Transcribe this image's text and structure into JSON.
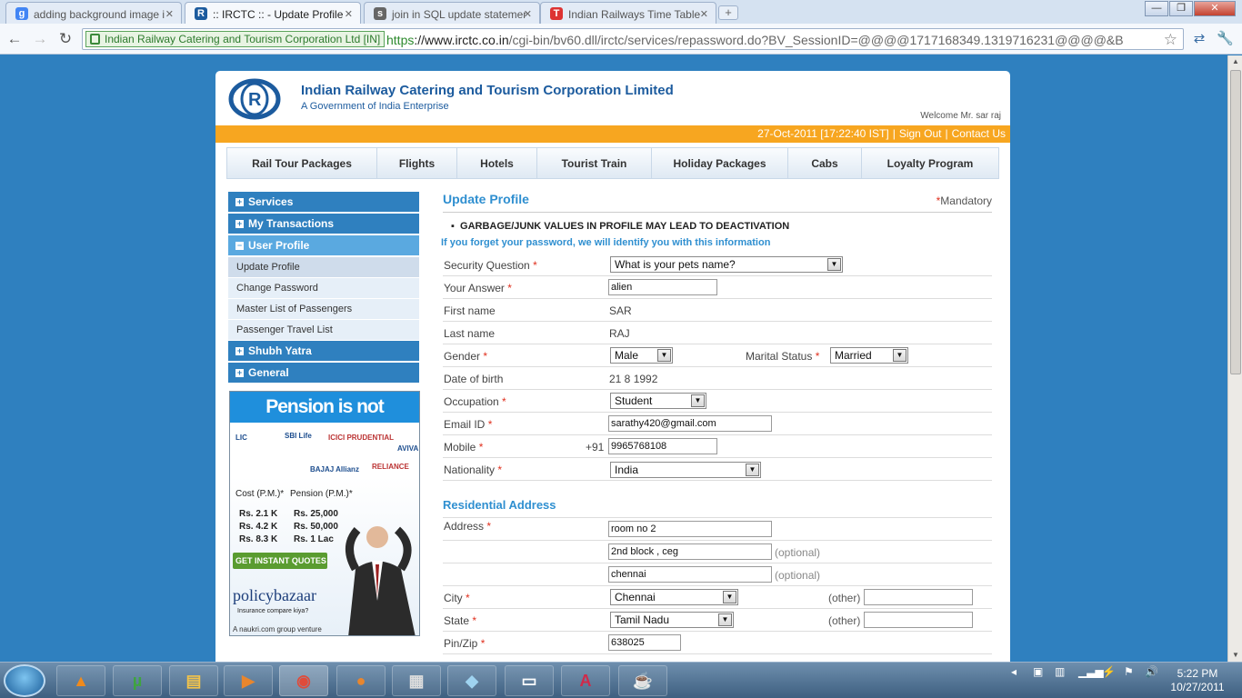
{
  "browser": {
    "tabs": [
      {
        "title": "adding background image i",
        "icon": "google-icon",
        "color": "#4285f4"
      },
      {
        "title": ":: IRCTC :: - Update Profile",
        "icon": "irctc-icon",
        "color": "#1c5b9e"
      },
      {
        "title": "join in SQL update statemer",
        "icon": "stackoverflow-icon",
        "color": "#666666"
      },
      {
        "title": "Indian Railways Time Table",
        "icon": "train-icon",
        "color": "#d33"
      }
    ],
    "new_tab_label": "+",
    "window_buttons": {
      "minimize": "—",
      "maximize": "❐",
      "close": "✕"
    },
    "ev_label": "Indian Railway Catering and Tourism Corporation Ltd [IN]",
    "url_scheme": "https",
    "url_host": "://www.irctc.co.in",
    "url_path": "/cgi-bin/bv60.dll/irctc/services/repassword.do?BV_SessionID=@@@@1717168349.1319716231@@@@&B"
  },
  "header": {
    "org_name": "Indian Railway Catering and Tourism Corporation Limited",
    "org_sub": "A Government of India Enterprise",
    "welcome": "Welcome Mr. sar raj",
    "datetime": "27-Oct-2011 [17:22:40 IST]",
    "signout": "Sign Out",
    "contact": "Contact Us"
  },
  "topnav": [
    "Rail Tour Packages",
    "Flights",
    "Hotels",
    "Tourist Train",
    "Holiday Packages",
    "Cabs",
    "Loyalty Program"
  ],
  "sidebar": {
    "services": "Services",
    "my_transactions": "My Transactions",
    "user_profile": "User Profile",
    "sub": [
      "Update Profile",
      "Change Password",
      "Master List of Passengers",
      "Passenger Travel List"
    ],
    "shubh_yatra": "Shubh Yatra",
    "general": "General"
  },
  "ad": {
    "title": "Pension is not expensive",
    "logos": [
      "LIC",
      "SBI Life",
      "ICICI PRUDENTIAL",
      "AVIVA",
      "BAJAJ Allianz",
      "RELIANCE"
    ],
    "col1_head": "Cost (P.M.)*",
    "col2_head": "Pension (P.M.)*",
    "rows": [
      [
        "Rs. 2.1 K",
        "Rs. 25,000"
      ],
      [
        "Rs. 4.2 K",
        "Rs. 50,000"
      ],
      [
        "Rs. 8.3 K",
        "Rs. 1 Lac"
      ]
    ],
    "quote_btn": "GET INSTANT QUOTES",
    "brand": "policybazaar",
    "brand_tag": "Insurance compare kiya?",
    "footer": "A naukri.com group venture"
  },
  "form": {
    "title": "Update Profile",
    "mandatory": "Mandatory",
    "warning": "GARBAGE/JUNK VALUES IN PROFILE MAY LEAD TO DEACTIVATION",
    "note": "If you forget your password, we will identify you with this information",
    "security_question_label": "Security Question",
    "security_question": "What is your pets name?",
    "answer_label": "Your Answer",
    "answer": "alien",
    "first_name_label": "First name",
    "first_name": "SAR",
    "last_name_label": "Last name",
    "last_name": "RAJ",
    "gender_label": "Gender",
    "gender": "Male",
    "marital_label": "Marital Status",
    "marital": "Married",
    "dob_label": "Date of birth",
    "dob": "21 8 1992",
    "occupation_label": "Occupation",
    "occupation": "Student",
    "email_label": "Email ID",
    "email": "sarathy420@gmail.com",
    "mobile_label": "Mobile",
    "mobile_prefix": "+91",
    "mobile": "9965768108",
    "nationality_label": "Nationality",
    "nationality": "India",
    "address_title": "Residential Address",
    "address_label": "Address",
    "address1": "room no 2",
    "address2": "2nd block , ceg",
    "address3": "chennai",
    "optional": "(optional)",
    "city_label": "City",
    "city": "Chennai",
    "other": "(other)",
    "state_label": "State",
    "state": "Tamil Nadu",
    "pin_label": "Pin/Zip",
    "pin": "638025"
  },
  "taskbar": {
    "time": "5:22 PM",
    "date": "10/27/2011"
  }
}
